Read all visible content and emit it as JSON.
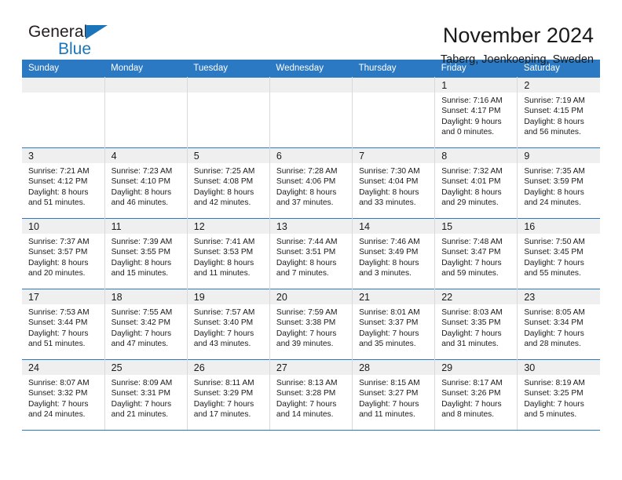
{
  "brand": {
    "name_part1": "General",
    "name_part2": "Blue",
    "flag_color": "#1b75bb"
  },
  "header": {
    "title": "November 2024",
    "location": "Taberg, Joenkoeping, Sweden"
  },
  "theme": {
    "header_bg": "#2b79c2",
    "daynum_bg": "#efefef",
    "grid_line": "#2b79c2"
  },
  "weekday_headers": [
    "Sunday",
    "Monday",
    "Tuesday",
    "Wednesday",
    "Thursday",
    "Friday",
    "Saturday"
  ],
  "weeks": [
    [
      {
        "day": "",
        "empty": true
      },
      {
        "day": "",
        "empty": true
      },
      {
        "day": "",
        "empty": true
      },
      {
        "day": "",
        "empty": true
      },
      {
        "day": "",
        "empty": true
      },
      {
        "day": "1",
        "sunrise": "Sunrise: 7:16 AM",
        "sunset": "Sunset: 4:17 PM",
        "daylight1": "Daylight: 9 hours",
        "daylight2": "and 0 minutes."
      },
      {
        "day": "2",
        "sunrise": "Sunrise: 7:19 AM",
        "sunset": "Sunset: 4:15 PM",
        "daylight1": "Daylight: 8 hours",
        "daylight2": "and 56 minutes."
      }
    ],
    [
      {
        "day": "3",
        "sunrise": "Sunrise: 7:21 AM",
        "sunset": "Sunset: 4:12 PM",
        "daylight1": "Daylight: 8 hours",
        "daylight2": "and 51 minutes."
      },
      {
        "day": "4",
        "sunrise": "Sunrise: 7:23 AM",
        "sunset": "Sunset: 4:10 PM",
        "daylight1": "Daylight: 8 hours",
        "daylight2": "and 46 minutes."
      },
      {
        "day": "5",
        "sunrise": "Sunrise: 7:25 AM",
        "sunset": "Sunset: 4:08 PM",
        "daylight1": "Daylight: 8 hours",
        "daylight2": "and 42 minutes."
      },
      {
        "day": "6",
        "sunrise": "Sunrise: 7:28 AM",
        "sunset": "Sunset: 4:06 PM",
        "daylight1": "Daylight: 8 hours",
        "daylight2": "and 37 minutes."
      },
      {
        "day": "7",
        "sunrise": "Sunrise: 7:30 AM",
        "sunset": "Sunset: 4:04 PM",
        "daylight1": "Daylight: 8 hours",
        "daylight2": "and 33 minutes."
      },
      {
        "day": "8",
        "sunrise": "Sunrise: 7:32 AM",
        "sunset": "Sunset: 4:01 PM",
        "daylight1": "Daylight: 8 hours",
        "daylight2": "and 29 minutes."
      },
      {
        "day": "9",
        "sunrise": "Sunrise: 7:35 AM",
        "sunset": "Sunset: 3:59 PM",
        "daylight1": "Daylight: 8 hours",
        "daylight2": "and 24 minutes."
      }
    ],
    [
      {
        "day": "10",
        "sunrise": "Sunrise: 7:37 AM",
        "sunset": "Sunset: 3:57 PM",
        "daylight1": "Daylight: 8 hours",
        "daylight2": "and 20 minutes."
      },
      {
        "day": "11",
        "sunrise": "Sunrise: 7:39 AM",
        "sunset": "Sunset: 3:55 PM",
        "daylight1": "Daylight: 8 hours",
        "daylight2": "and 15 minutes."
      },
      {
        "day": "12",
        "sunrise": "Sunrise: 7:41 AM",
        "sunset": "Sunset: 3:53 PM",
        "daylight1": "Daylight: 8 hours",
        "daylight2": "and 11 minutes."
      },
      {
        "day": "13",
        "sunrise": "Sunrise: 7:44 AM",
        "sunset": "Sunset: 3:51 PM",
        "daylight1": "Daylight: 8 hours",
        "daylight2": "and 7 minutes."
      },
      {
        "day": "14",
        "sunrise": "Sunrise: 7:46 AM",
        "sunset": "Sunset: 3:49 PM",
        "daylight1": "Daylight: 8 hours",
        "daylight2": "and 3 minutes."
      },
      {
        "day": "15",
        "sunrise": "Sunrise: 7:48 AM",
        "sunset": "Sunset: 3:47 PM",
        "daylight1": "Daylight: 7 hours",
        "daylight2": "and 59 minutes."
      },
      {
        "day": "16",
        "sunrise": "Sunrise: 7:50 AM",
        "sunset": "Sunset: 3:45 PM",
        "daylight1": "Daylight: 7 hours",
        "daylight2": "and 55 minutes."
      }
    ],
    [
      {
        "day": "17",
        "sunrise": "Sunrise: 7:53 AM",
        "sunset": "Sunset: 3:44 PM",
        "daylight1": "Daylight: 7 hours",
        "daylight2": "and 51 minutes."
      },
      {
        "day": "18",
        "sunrise": "Sunrise: 7:55 AM",
        "sunset": "Sunset: 3:42 PM",
        "daylight1": "Daylight: 7 hours",
        "daylight2": "and 47 minutes."
      },
      {
        "day": "19",
        "sunrise": "Sunrise: 7:57 AM",
        "sunset": "Sunset: 3:40 PM",
        "daylight1": "Daylight: 7 hours",
        "daylight2": "and 43 minutes."
      },
      {
        "day": "20",
        "sunrise": "Sunrise: 7:59 AM",
        "sunset": "Sunset: 3:38 PM",
        "daylight1": "Daylight: 7 hours",
        "daylight2": "and 39 minutes."
      },
      {
        "day": "21",
        "sunrise": "Sunrise: 8:01 AM",
        "sunset": "Sunset: 3:37 PM",
        "daylight1": "Daylight: 7 hours",
        "daylight2": "and 35 minutes."
      },
      {
        "day": "22",
        "sunrise": "Sunrise: 8:03 AM",
        "sunset": "Sunset: 3:35 PM",
        "daylight1": "Daylight: 7 hours",
        "daylight2": "and 31 minutes."
      },
      {
        "day": "23",
        "sunrise": "Sunrise: 8:05 AM",
        "sunset": "Sunset: 3:34 PM",
        "daylight1": "Daylight: 7 hours",
        "daylight2": "and 28 minutes."
      }
    ],
    [
      {
        "day": "24",
        "sunrise": "Sunrise: 8:07 AM",
        "sunset": "Sunset: 3:32 PM",
        "daylight1": "Daylight: 7 hours",
        "daylight2": "and 24 minutes."
      },
      {
        "day": "25",
        "sunrise": "Sunrise: 8:09 AM",
        "sunset": "Sunset: 3:31 PM",
        "daylight1": "Daylight: 7 hours",
        "daylight2": "and 21 minutes."
      },
      {
        "day": "26",
        "sunrise": "Sunrise: 8:11 AM",
        "sunset": "Sunset: 3:29 PM",
        "daylight1": "Daylight: 7 hours",
        "daylight2": "and 17 minutes."
      },
      {
        "day": "27",
        "sunrise": "Sunrise: 8:13 AM",
        "sunset": "Sunset: 3:28 PM",
        "daylight1": "Daylight: 7 hours",
        "daylight2": "and 14 minutes."
      },
      {
        "day": "28",
        "sunrise": "Sunrise: 8:15 AM",
        "sunset": "Sunset: 3:27 PM",
        "daylight1": "Daylight: 7 hours",
        "daylight2": "and 11 minutes."
      },
      {
        "day": "29",
        "sunrise": "Sunrise: 8:17 AM",
        "sunset": "Sunset: 3:26 PM",
        "daylight1": "Daylight: 7 hours",
        "daylight2": "and 8 minutes."
      },
      {
        "day": "30",
        "sunrise": "Sunrise: 8:19 AM",
        "sunset": "Sunset: 3:25 PM",
        "daylight1": "Daylight: 7 hours",
        "daylight2": "and 5 minutes."
      }
    ]
  ]
}
